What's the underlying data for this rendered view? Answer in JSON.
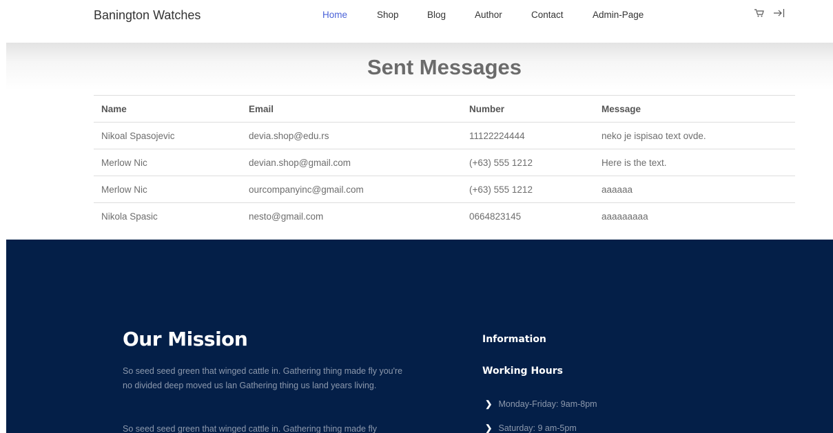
{
  "header": {
    "brand": "Banington Watches",
    "nav": [
      {
        "label": "Home",
        "active": true
      },
      {
        "label": "Shop",
        "active": false
      },
      {
        "label": "Blog",
        "active": false
      },
      {
        "label": "Author",
        "active": false
      },
      {
        "label": "Contact",
        "active": false
      },
      {
        "label": "Admin-Page",
        "active": false
      }
    ],
    "icons": [
      "cart-icon",
      "logout-icon"
    ]
  },
  "main": {
    "title": "Sent Messages",
    "table": {
      "columns": [
        "Name",
        "Email",
        "Number",
        "Message"
      ],
      "rows": [
        [
          "Nikoal Spasojevic",
          "devia.shop@edu.rs",
          "11122224444",
          "neko je ispisao text ovde."
        ],
        [
          "Merlow Nic",
          "devian.shop@gmail.com",
          "(+63) 555 1212",
          "Here is the text."
        ],
        [
          "Merlow Nic",
          "ourcompanyinc@gmail.com",
          "(+63) 555 1212",
          "aaaaaa"
        ],
        [
          "Nikola Spasic",
          "nesto@gmail.com",
          "0664823145",
          "aaaaaaaaa"
        ]
      ]
    }
  },
  "footer": {
    "mission_title": "Our Mission",
    "mission_paragraphs": [
      "So seed seed green that winged cattle in. Gathering thing made fly you're no divided deep moved us lan Gathering thing us land years living.",
      "So seed seed green that winged cattle in. Gathering thing made fly"
    ],
    "info_title": "Information",
    "hours_title": "Working Hours",
    "hours": [
      "Monday-Friday: 9am-8pm",
      "Saturday: 9 am-5pm"
    ]
  },
  "colors": {
    "footer_bg": "#041f48",
    "nav_active": "#4a62d8"
  }
}
